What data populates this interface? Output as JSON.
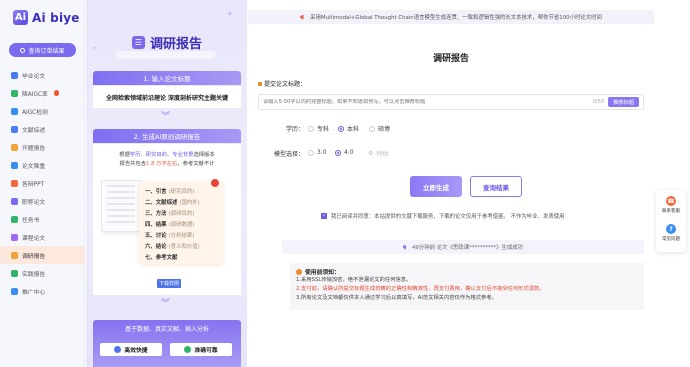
{
  "brand": {
    "logo_mark": "Ai",
    "name": "Ai biye"
  },
  "sidebar": {
    "search_label": "查询订单结果",
    "items": [
      {
        "label": "毕业论文",
        "icon": "graduation-icon",
        "color": "#4a7cf0"
      },
      {
        "label": "降AIGC率",
        "icon": "shield-icon",
        "color": "#34b36a",
        "hot": true
      },
      {
        "label": "AIGC检测",
        "icon": "scan-icon",
        "color": "#3a8ef0"
      },
      {
        "label": "文献综述",
        "icon": "book-icon",
        "color": "#4a7cf0"
      },
      {
        "label": "开题报告",
        "icon": "report-icon",
        "color": "#f0a33a"
      },
      {
        "label": "论文降重",
        "icon": "edit-icon",
        "color": "#3a8ef0"
      },
      {
        "label": "答辩PPT",
        "icon": "ppt-icon",
        "color": "#f06a3a"
      },
      {
        "label": "职称论文",
        "icon": "award-icon",
        "color": "#7a6af0"
      },
      {
        "label": "任务书",
        "icon": "task-icon",
        "color": "#34b36a"
      },
      {
        "label": "课程论文",
        "icon": "course-icon",
        "color": "#a06af0"
      },
      {
        "label": "调研报告",
        "icon": "survey-icon",
        "color": "#f0a33a",
        "active": true
      },
      {
        "label": "实践报告",
        "icon": "practice-icon",
        "color": "#34b36a"
      },
      {
        "label": "推广中心",
        "icon": "promo-icon",
        "color": "#3a8ef0"
      }
    ]
  },
  "promo": {
    "title": "调研报告",
    "step1_title": "1. 输入论文标题",
    "step1_example": "全网检索领域前沿理论 深度剖析研究主题关键",
    "step2_title": "2. 生成AI原创调研报告",
    "step2_desc_1": "根据",
    "step2_desc_hl1": "学历、研究目的、专业背景",
    "step2_desc_2": "选择版本",
    "step2_desc_3": "报告共包含",
    "step2_desc_red": "1.8 万字左右",
    "step2_desc_4": "，参考文献不计",
    "outline": [
      {
        "label": "一、引言",
        "note": "(研究目的)"
      },
      {
        "label": "二、文献综述",
        "note": "(国内外)"
      },
      {
        "label": "三、方法",
        "note": "(调研目的)"
      },
      {
        "label": "四、结果",
        "note": "(调研数据)"
      },
      {
        "label": "五、讨论",
        "note": "(分析结果)"
      },
      {
        "label": "六、结论",
        "note": "(意义和价值)"
      },
      {
        "label": "七、参考文献",
        "note": ""
      }
    ],
    "sample_btn": "下载样例",
    "step3_title": "基于数据、真实文献、插入分析",
    "features": [
      {
        "label": "高效快捷",
        "color": "#4f74ea"
      },
      {
        "label": "准确可靠",
        "color": "#34b36a"
      }
    ]
  },
  "main": {
    "banner": "采用Multimodal+Global Thought Chain语言模型生成连贯、一致和逻辑性强的长文本技术，帮你节省100小时论文时间",
    "title": "调研报告",
    "topic_label": "提交论文标题：",
    "topic_placeholder": "请输入5-50字以内的完整标题，如果不知道如何写，可以点击推荐标题",
    "topic_counter": "0/50",
    "recommend_btn": "推荐标题",
    "degree_label": "学历：",
    "degree_options": [
      "专科",
      "本科",
      "硕博"
    ],
    "degree_selected": 1,
    "model_label": "模型选择：",
    "model_options": [
      "3.0",
      "4.0",
      "特供"
    ],
    "model_selected": 1,
    "generate_btn": "立即生成",
    "query_btn": "查询结果",
    "agree_text": "我已阅读并同意：本站提供的文献下载服务，下载的论文仅用于参考借鉴。 不作为毕业、发表使用",
    "success_text": "49分钟前 论文《思政课**********》生成成功",
    "notice_title": "使用前须知：",
    "notice_lines": [
      {
        "text": "1.采用SSL传输加密，绝不泄漏论文的任何信息。",
        "red": false
      },
      {
        "text": "2.支付前，请确认所提交标题生成范畴的正确性和精准性，再支付费用，确认支付后不接受任何形式退款。",
        "red": true
      },
      {
        "text": "3.所有论文及文档都仅供本人通过学习后以真填写，AI范文相关内容仅作为格式参考。",
        "red": false
      }
    ]
  },
  "float_panel": {
    "items": [
      {
        "label": "联系客服",
        "icon": "service-icon",
        "glyph": "☎",
        "color": "#f06a3a"
      },
      {
        "label": "常见问题",
        "icon": "help-icon",
        "glyph": "?",
        "color": "#3a8ef0"
      }
    ]
  }
}
